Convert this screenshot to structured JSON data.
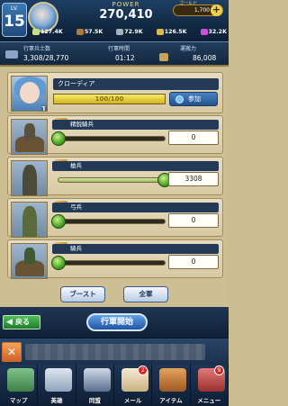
{
  "header": {
    "level_label": "LV.",
    "level": "15",
    "power_label": "POWER",
    "power": "270,410",
    "gold_label": "ゴールド",
    "gold": "1,700",
    "resources": [
      "127.4K",
      "57.5K",
      "72.9K",
      "126.5K",
      "32.2K"
    ]
  },
  "info": {
    "troops_label": "行軍兵士数",
    "troops": "3,308/28,770",
    "time_label": "行軍時間",
    "time": "01:12",
    "capacity_label": "運搬力",
    "capacity": "86,008"
  },
  "commander": {
    "name": "クローディア",
    "bar_text": "100/100",
    "bar_fraction": 1.0,
    "level": "15",
    "join_label": "参加"
  },
  "units": [
    {
      "name": "精鋭騎兵",
      "value": "0",
      "fraction": 0.0
    },
    {
      "name": "槍兵",
      "value": "3308",
      "fraction": 1.0
    },
    {
      "name": "弓兵",
      "value": "0",
      "fraction": 0.0
    },
    {
      "name": "騎兵",
      "value": "0",
      "fraction": 0.0
    }
  ],
  "buttons": {
    "boost": "ブースト",
    "all": "全軍",
    "back": "戻る",
    "march": "行軍開始"
  },
  "nav": [
    {
      "label": "マップ",
      "badge": ""
    },
    {
      "label": "英雄",
      "badge": ""
    },
    {
      "label": "同盟",
      "badge": ""
    },
    {
      "label": "メール",
      "badge": "2"
    },
    {
      "label": "アイテム",
      "badge": ""
    },
    {
      "label": "メニュー",
      "badge": "9"
    }
  ],
  "colors": {
    "header_bg": "#1e3f63",
    "content_bg": "#cdbf93",
    "accent_blue": "#2a5ea5",
    "slider_green": "#4aa322",
    "back_green": "#2f9a3b"
  }
}
